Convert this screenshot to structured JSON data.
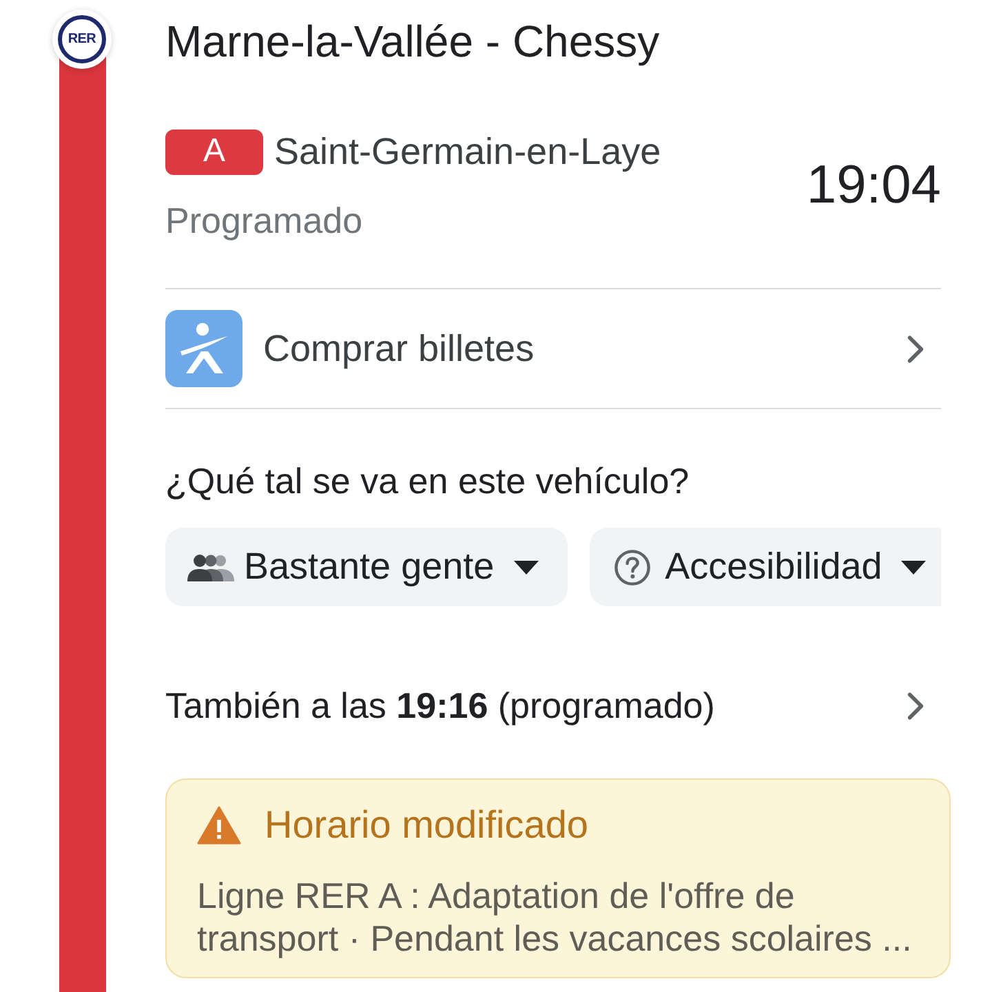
{
  "stop": {
    "network_badge": "RER",
    "name": "Marne-la-Vallée - Chessy"
  },
  "departure": {
    "line": "A",
    "destination": "Saint-Germain-en-Laye",
    "status": "Programado",
    "time": "19:04"
  },
  "tickets": {
    "label": "Comprar billetes"
  },
  "crowding": {
    "question": "¿Qué tal se va en este vehículo?",
    "chips": [
      {
        "kind": "crowding",
        "label": "Bastante gente"
      },
      {
        "kind": "accessibility",
        "label": "Accesibilidad"
      }
    ]
  },
  "next_departure": {
    "text": "También a las **19:16** (programado)"
  },
  "alert": {
    "title": "Horario modificado",
    "body": "Ligne RER A : Adaptation de l'offre de transport · Pendant les vacances scolaires ..."
  }
}
